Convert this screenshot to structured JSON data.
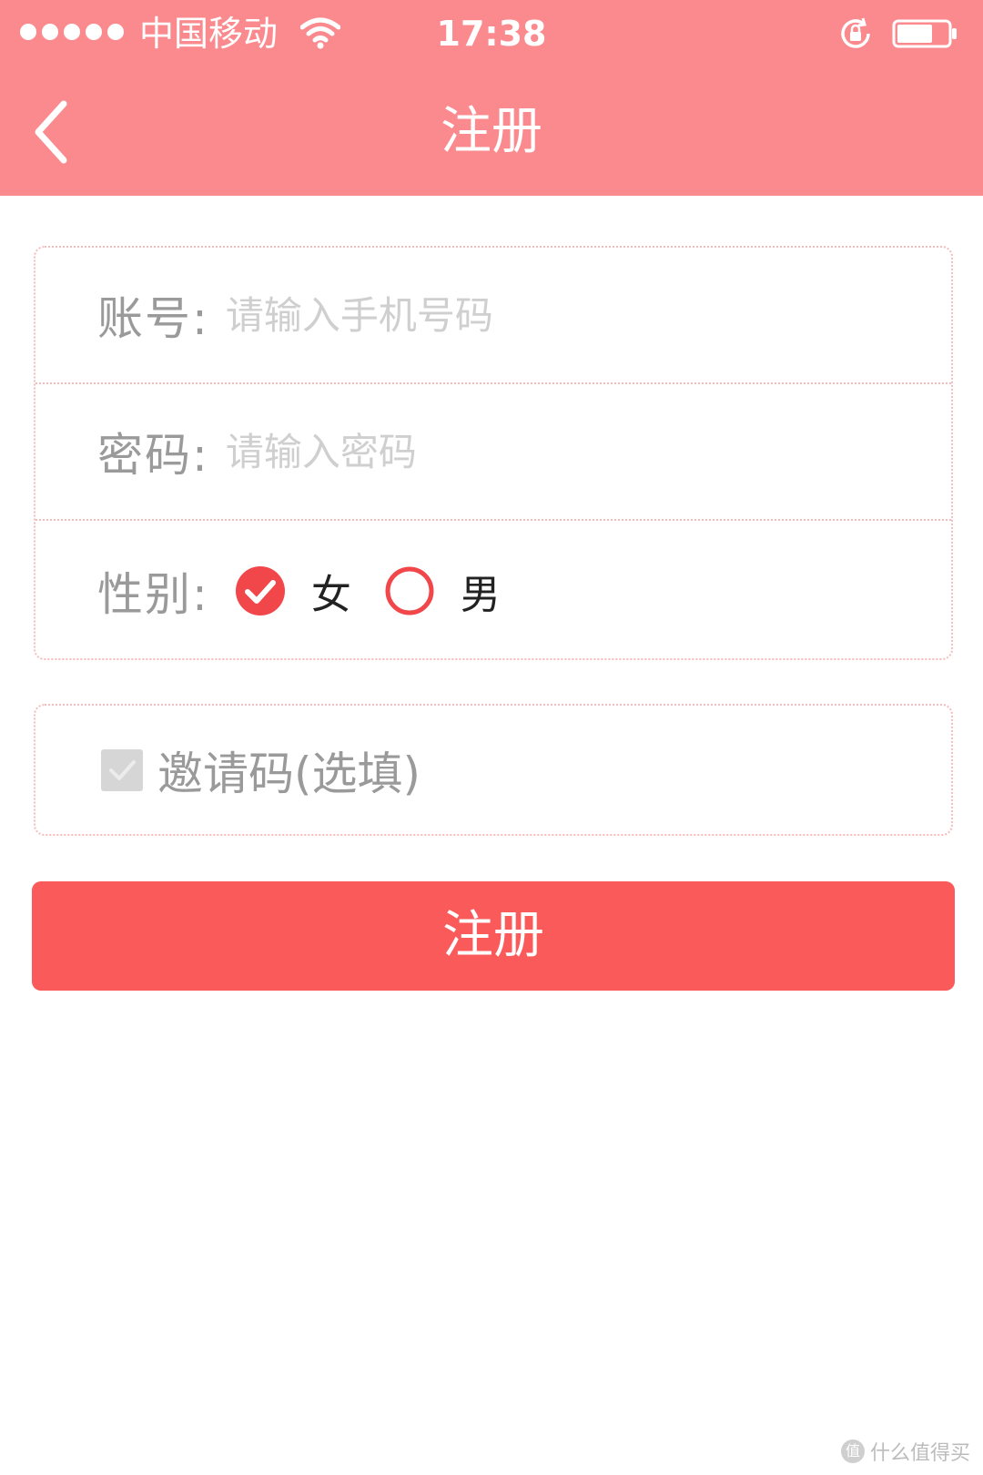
{
  "status_bar": {
    "carrier": "中国移动",
    "time": "17:38",
    "signal_dots": 5
  },
  "nav": {
    "back_icon": "chevron-left-icon",
    "title": "注册"
  },
  "form": {
    "account": {
      "label": "账号:",
      "placeholder": "请输入手机号码",
      "value": ""
    },
    "password": {
      "label": "密码:",
      "placeholder": "请输入密码",
      "value": ""
    },
    "gender": {
      "label": "性别:",
      "options": [
        {
          "label": "女",
          "selected": true
        },
        {
          "label": "男",
          "selected": false
        }
      ]
    }
  },
  "invite": {
    "label": "邀请码(选填)",
    "checked": true
  },
  "submit_label": "注册",
  "watermark": {
    "icon": "值",
    "text": "什么值得买"
  },
  "colors": {
    "header": "#fb8a8e",
    "accent": "#f1474b",
    "button": "#fb5a5b",
    "border": "#f4bcbc"
  }
}
